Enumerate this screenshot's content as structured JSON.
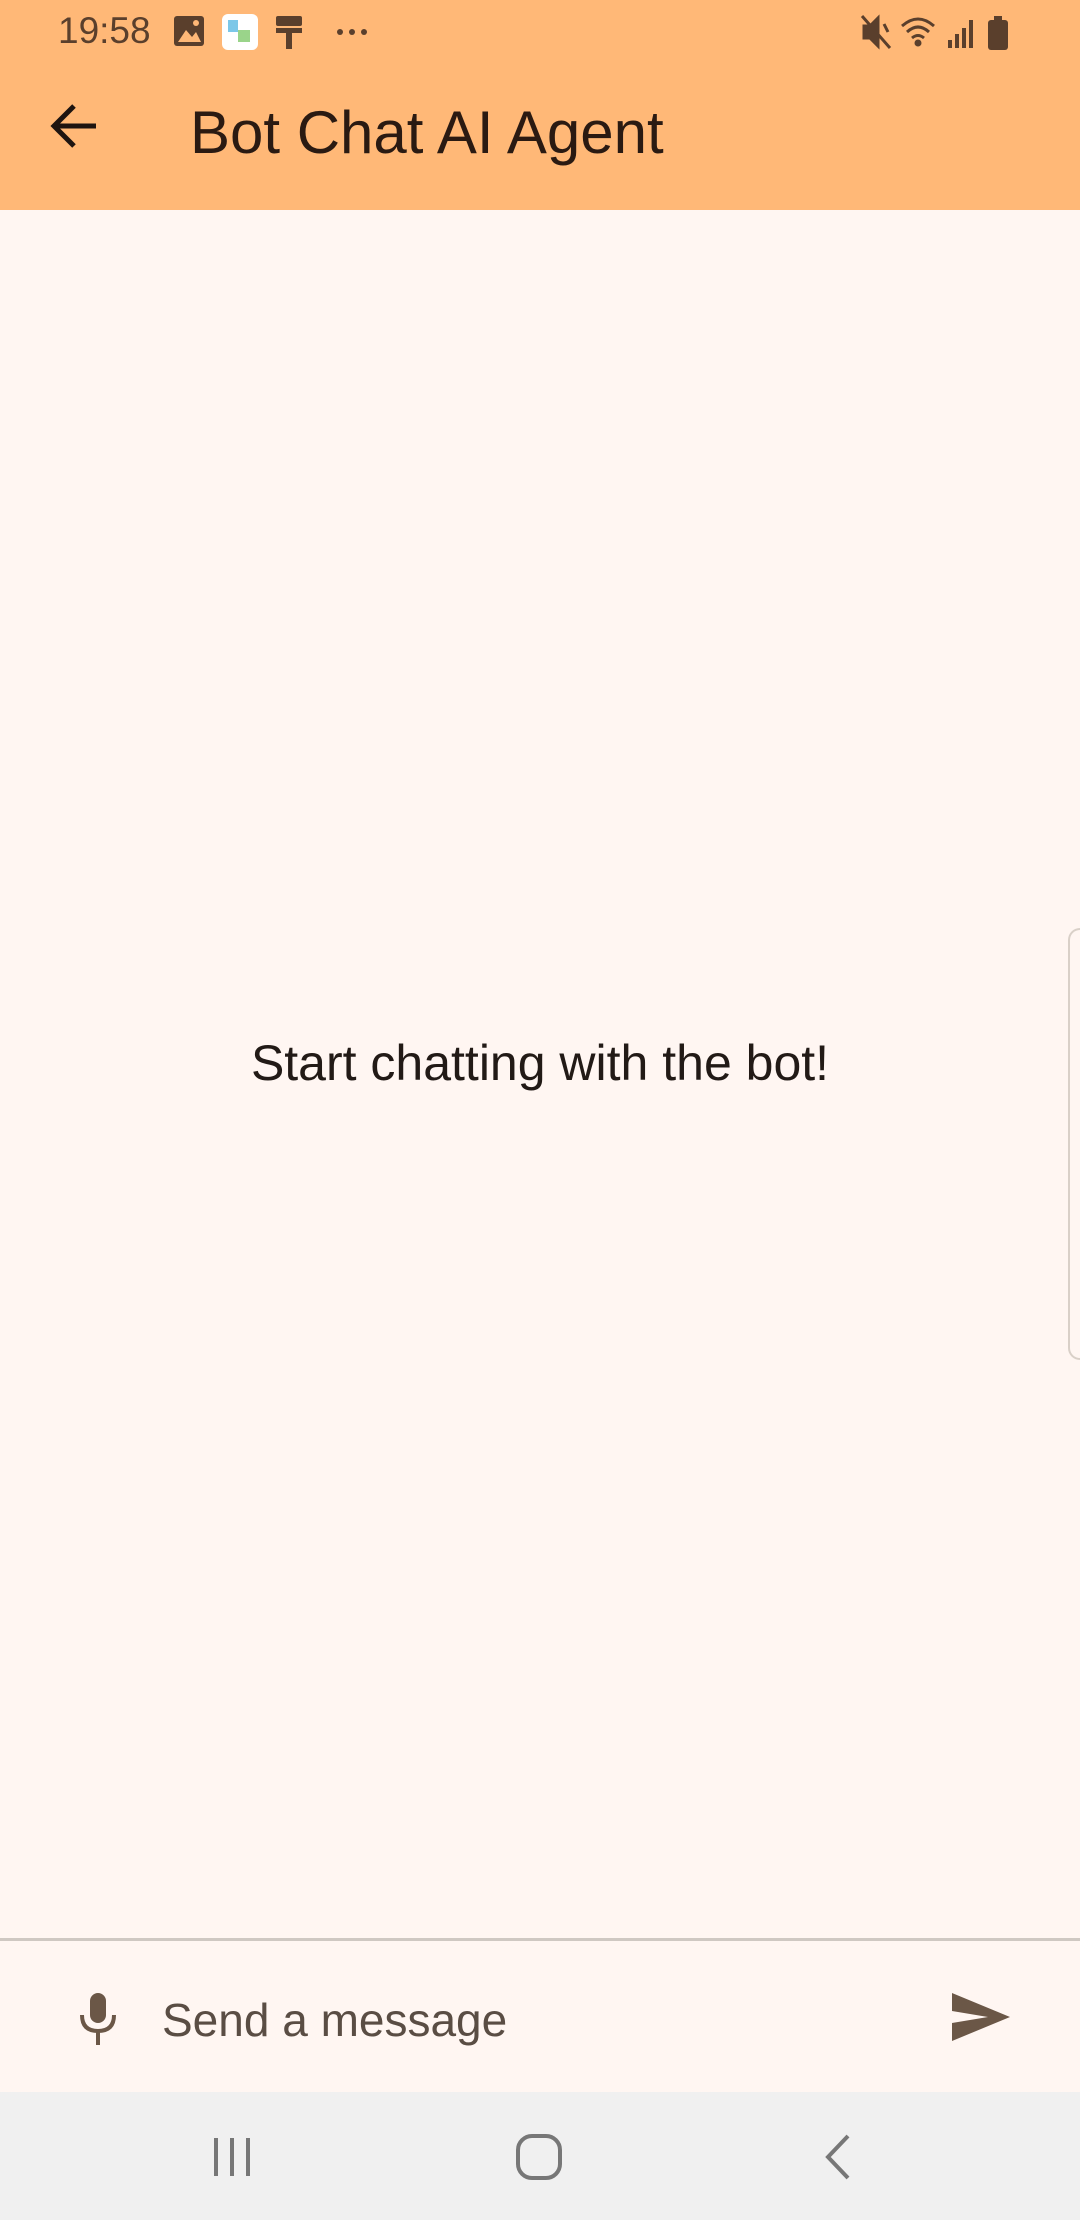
{
  "status_bar": {
    "time": "19:58",
    "left_icons": [
      "gallery-icon",
      "app-notification-icon",
      "paint-roller-icon",
      "more-notifications-icon"
    ],
    "right_icons": [
      "vibrate-mute-icon",
      "wifi-icon",
      "signal-icon",
      "battery-icon"
    ]
  },
  "app_bar": {
    "back_icon": "arrow-back-icon",
    "title": "Bot Chat AI Agent",
    "background_color": "#ffb877"
  },
  "chat": {
    "empty_message": "Start chatting with the bot!"
  },
  "composer": {
    "mic_icon": "microphone-icon",
    "placeholder": "Send a message",
    "value": "",
    "send_icon": "send-icon"
  },
  "nav_bar": {
    "buttons": [
      "recent-apps-icon",
      "home-icon",
      "back-icon"
    ]
  }
}
